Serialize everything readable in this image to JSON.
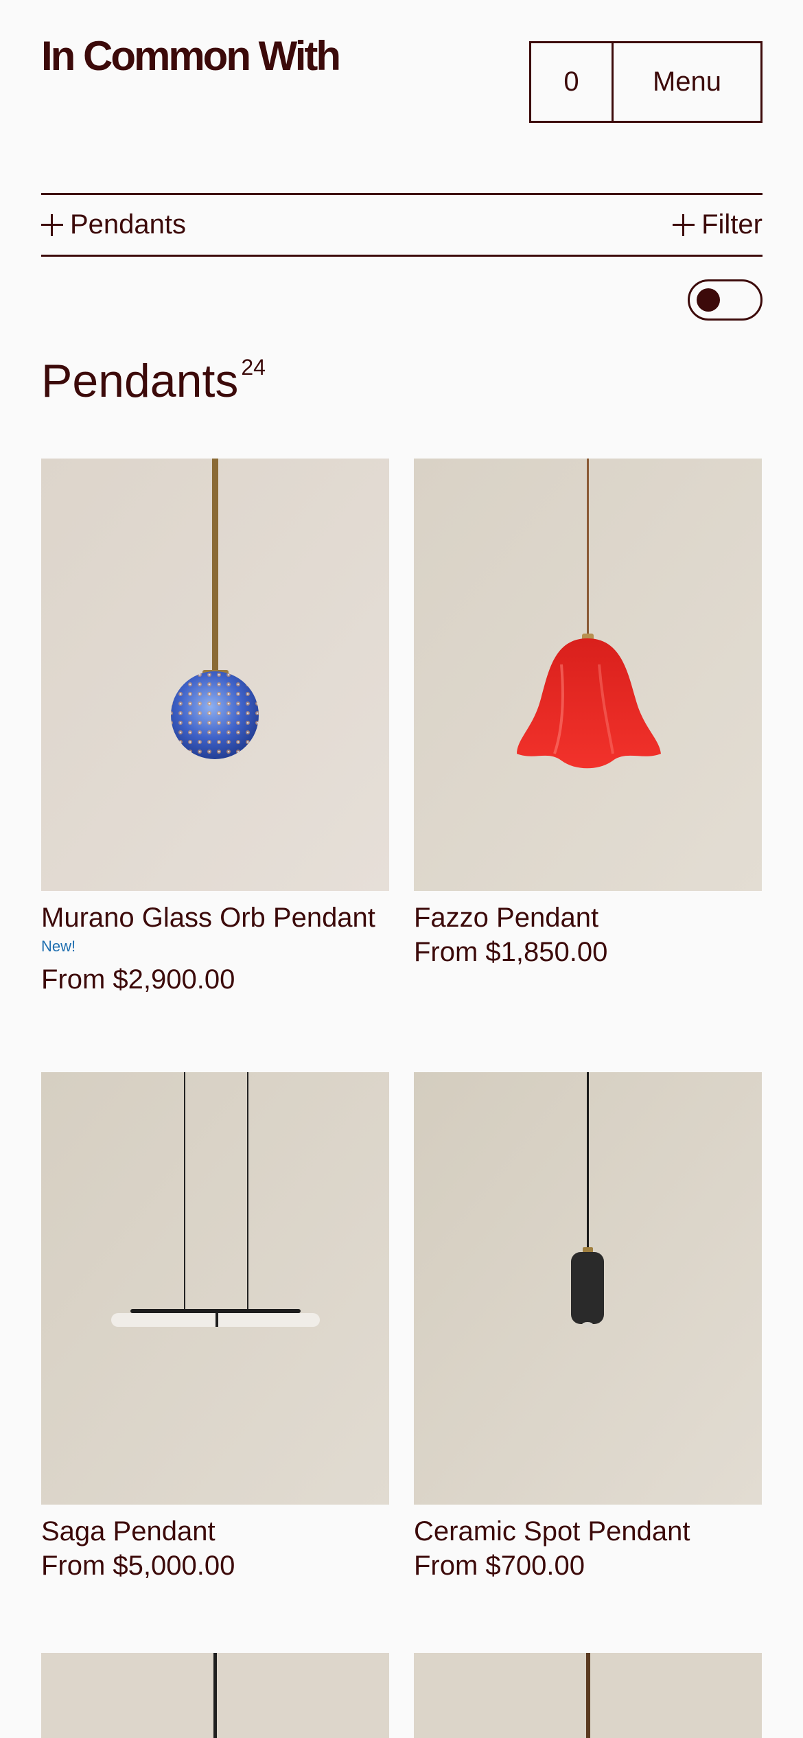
{
  "header": {
    "logo": "In Common With",
    "cart_count": "0",
    "menu_label": "Menu"
  },
  "filter_bar": {
    "category_label": "Pendants",
    "filter_label": "Filter"
  },
  "page_title": {
    "title": "Pendants",
    "count": "24"
  },
  "products": [
    {
      "name": "Murano Glass Orb Pendant",
      "badge": "New!",
      "price": "From $2,900.00"
    },
    {
      "name": "Fazzo Pendant",
      "price": "From $1,850.00"
    },
    {
      "name": "Saga Pendant",
      "price": "From $5,000.00"
    },
    {
      "name": "Ceramic Spot Pendant",
      "price": "From $700.00"
    }
  ],
  "colors": {
    "brand": "#3c0a0a",
    "background": "#fafafa",
    "badge": "#1f6fb0"
  }
}
